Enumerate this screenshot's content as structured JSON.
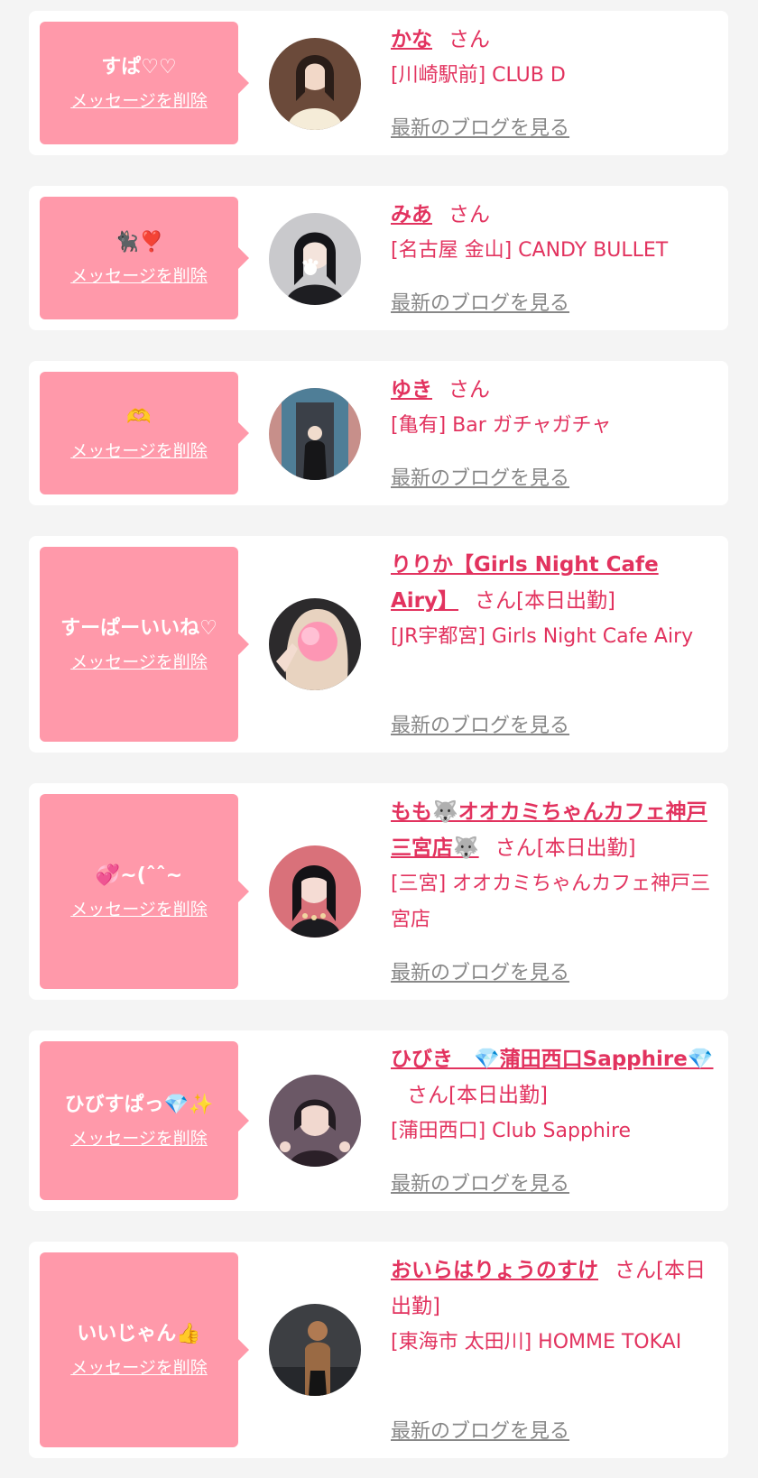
{
  "theme": {
    "bubble": "#ff99aa",
    "accent": "#e2335f",
    "link_gray": "#888888",
    "card": "#ffffff",
    "background": "#f4f4f4"
  },
  "delete_label": "メッセージを削除",
  "blog_label": "最新のブログを見る",
  "entries": [
    {
      "message": "すぱ♡♡",
      "name": "かな",
      "suffix": "さん",
      "shop": "[川崎駅前] CLUB D",
      "avatar_icon": "profile-photo",
      "avatar_color": "#6b4a3a"
    },
    {
      "message": "🐈‍⬛❣️",
      "name": "みあ",
      "suffix": "さん",
      "shop": "[名古屋 金山] CANDY BULLET",
      "avatar_icon": "profile-photo",
      "avatar_color": "#c9c9cc"
    },
    {
      "message": "🫶",
      "name": "ゆき",
      "suffix": "さん",
      "shop": "[亀有] Bar ガチャガチャ",
      "avatar_icon": "profile-photo",
      "avatar_color": "#4f7e97"
    },
    {
      "message": "すーぱーいいね♡",
      "name": "りりか【Girls Night Cafe Airy】",
      "suffix": "さん[本日出勤]",
      "shop": "[JR宇都宮] Girls Night Cafe Airy",
      "avatar_icon": "profile-photo",
      "avatar_color": "#e8d3c0"
    },
    {
      "message": "💞~(ˆˆ~",
      "name": "もも🐺オオカミちゃんカフェ神戸三宮店🐺",
      "suffix": "さん[本日出勤]",
      "shop": "[三宮] オオカミちゃんカフェ神戸三宮店",
      "avatar_icon": "profile-photo",
      "avatar_color": "#d9717a"
    },
    {
      "message": "ひびすぱっ💎✨",
      "name": "ひびき　💎蒲田西口Sapphire💎",
      "suffix": "さん[本日出勤]",
      "shop": "[蒲田西口] Club Sapphire",
      "avatar_icon": "profile-photo",
      "avatar_color": "#6b5866"
    },
    {
      "message": "いいじゃん👍",
      "name": "おいらはりょうのすけ",
      "suffix": "さん[本日出勤]",
      "shop": "[東海市 太田川] HOMME TOKAI",
      "avatar_icon": "profile-photo",
      "avatar_color": "#3d3f43"
    }
  ]
}
